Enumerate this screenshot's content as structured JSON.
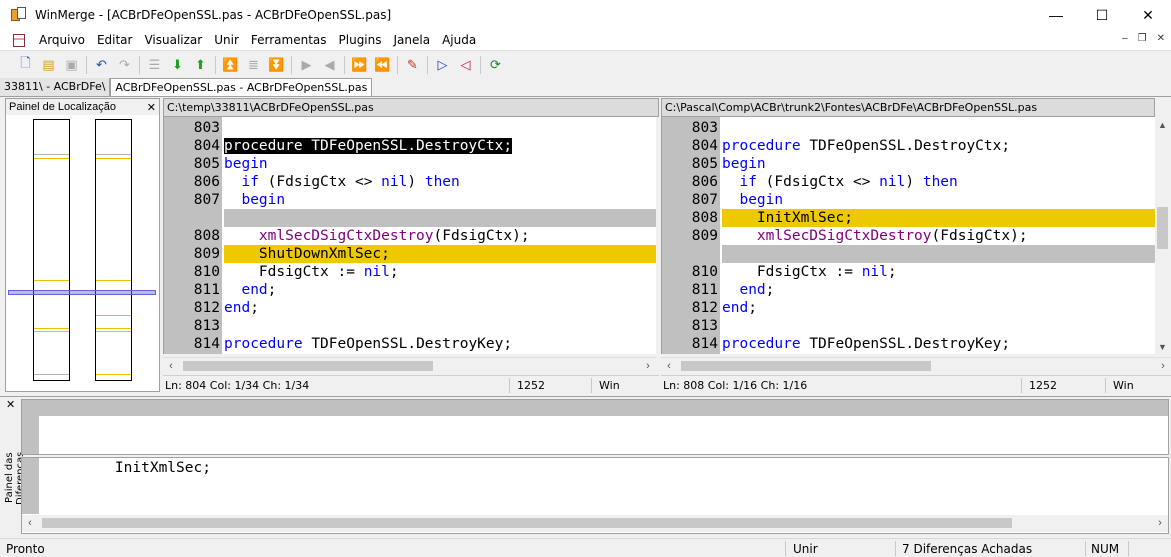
{
  "window": {
    "title": "WinMerge - [ACBrDFeOpenSSL.pas - ACBrDFeOpenSSL.pas]"
  },
  "menu": [
    "Arquivo",
    "Editar",
    "Visualizar",
    "Unir",
    "Ferramentas",
    "Plugins",
    "Janela",
    "Ajuda"
  ],
  "tabs": [
    "33811\\ - ACBrDFe\\",
    "ACBrDFeOpenSSL.pas - ACBrDFeOpenSSL.pas"
  ],
  "location_pane": {
    "title": "Painel de Localização"
  },
  "left": {
    "path": "C:\\temp\\33811\\ACBrDFeOpenSSL.pas",
    "lines": [
      {
        "num": "803",
        "text": "",
        "kind": "normal"
      },
      {
        "num": "804",
        "text": "procedure TDFeOpenSSL.DestroyCtx;",
        "kind": "selected"
      },
      {
        "num": "805",
        "text": "begin",
        "kind": "normal"
      },
      {
        "num": "806",
        "text": "  if (FdsigCtx <> nil) then",
        "kind": "normal"
      },
      {
        "num": "807",
        "text": "  begin",
        "kind": "normal"
      },
      {
        "num": "",
        "text": "",
        "kind": "blank"
      },
      {
        "num": "808",
        "text": "    xmlSecDSigCtxDestroy(FdsigCtx);",
        "kind": "normal"
      },
      {
        "num": "809",
        "text": "    ShutDownXmlSec;",
        "kind": "diff"
      },
      {
        "num": "810",
        "text": "    FdsigCtx := nil;",
        "kind": "normal"
      },
      {
        "num": "811",
        "text": "  end;",
        "kind": "normal"
      },
      {
        "num": "812",
        "text": "end;",
        "kind": "normal"
      },
      {
        "num": "813",
        "text": "",
        "kind": "normal"
      },
      {
        "num": "814",
        "text": "procedure TDFeOpenSSL.DestroyKey;",
        "kind": "normal"
      }
    ],
    "status": {
      "pos": "Ln: 804  Col: 1/34  Ch: 1/34",
      "codepage": "1252",
      "eol": "Win"
    }
  },
  "right": {
    "path": "C:\\Pascal\\Comp\\ACBr\\trunk2\\Fontes\\ACBrDFe\\ACBrDFeOpenSSL.pas",
    "lines": [
      {
        "num": "803",
        "text": "",
        "kind": "normal"
      },
      {
        "num": "804",
        "text": "procedure TDFeOpenSSL.DestroyCtx;",
        "kind": "normal"
      },
      {
        "num": "805",
        "text": "begin",
        "kind": "normal"
      },
      {
        "num": "806",
        "text": "  if (FdsigCtx <> nil) then",
        "kind": "normal"
      },
      {
        "num": "807",
        "text": "  begin",
        "kind": "normal"
      },
      {
        "num": "808",
        "text": "    InitXmlSec;",
        "kind": "diff"
      },
      {
        "num": "809",
        "text": "    xmlSecDSigCtxDestroy(FdsigCtx);",
        "kind": "normal"
      },
      {
        "num": "",
        "text": "",
        "kind": "blank"
      },
      {
        "num": "810",
        "text": "    FdsigCtx := nil;",
        "kind": "normal"
      },
      {
        "num": "811",
        "text": "  end;",
        "kind": "normal"
      },
      {
        "num": "812",
        "text": "end;",
        "kind": "normal"
      },
      {
        "num": "813",
        "text": "",
        "kind": "normal"
      },
      {
        "num": "814",
        "text": "procedure TDFeOpenSSL.DestroyKey;",
        "kind": "normal"
      }
    ],
    "status": {
      "pos": "Ln: 808  Col: 1/16  Ch: 1/16",
      "codepage": "1252",
      "eol": "Win"
    }
  },
  "diff_pane": {
    "title": "Painel das Diferenças",
    "bottom_text": "    InitXmlSec;"
  },
  "statusbar": {
    "ready": "Pronto",
    "mode": "Unir",
    "diffs": "7 Diferenças Achadas",
    "numlock": "NUM"
  }
}
